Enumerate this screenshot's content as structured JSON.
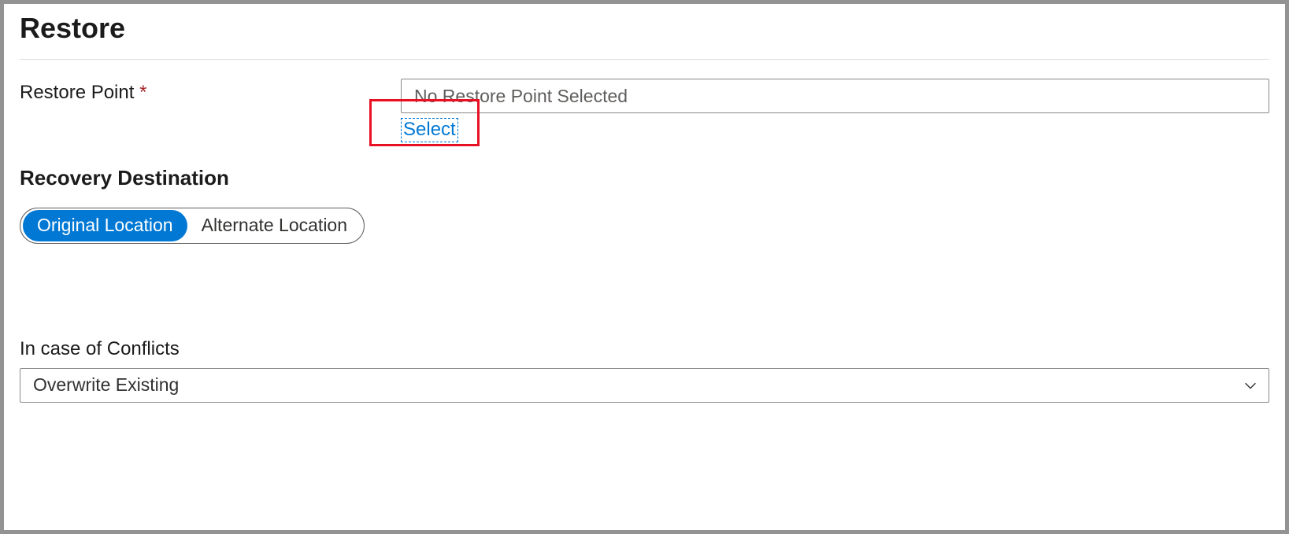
{
  "header": {
    "title": "Restore"
  },
  "restorePoint": {
    "label": "Restore Point",
    "requiredMark": "*",
    "value": "No Restore Point Selected",
    "selectLink": "Select"
  },
  "recoveryDestination": {
    "label": "Recovery Destination",
    "options": {
      "original": "Original Location",
      "alternate": "Alternate Location"
    }
  },
  "conflicts": {
    "label": "In case of Conflicts",
    "selected": "Overwrite Existing"
  }
}
